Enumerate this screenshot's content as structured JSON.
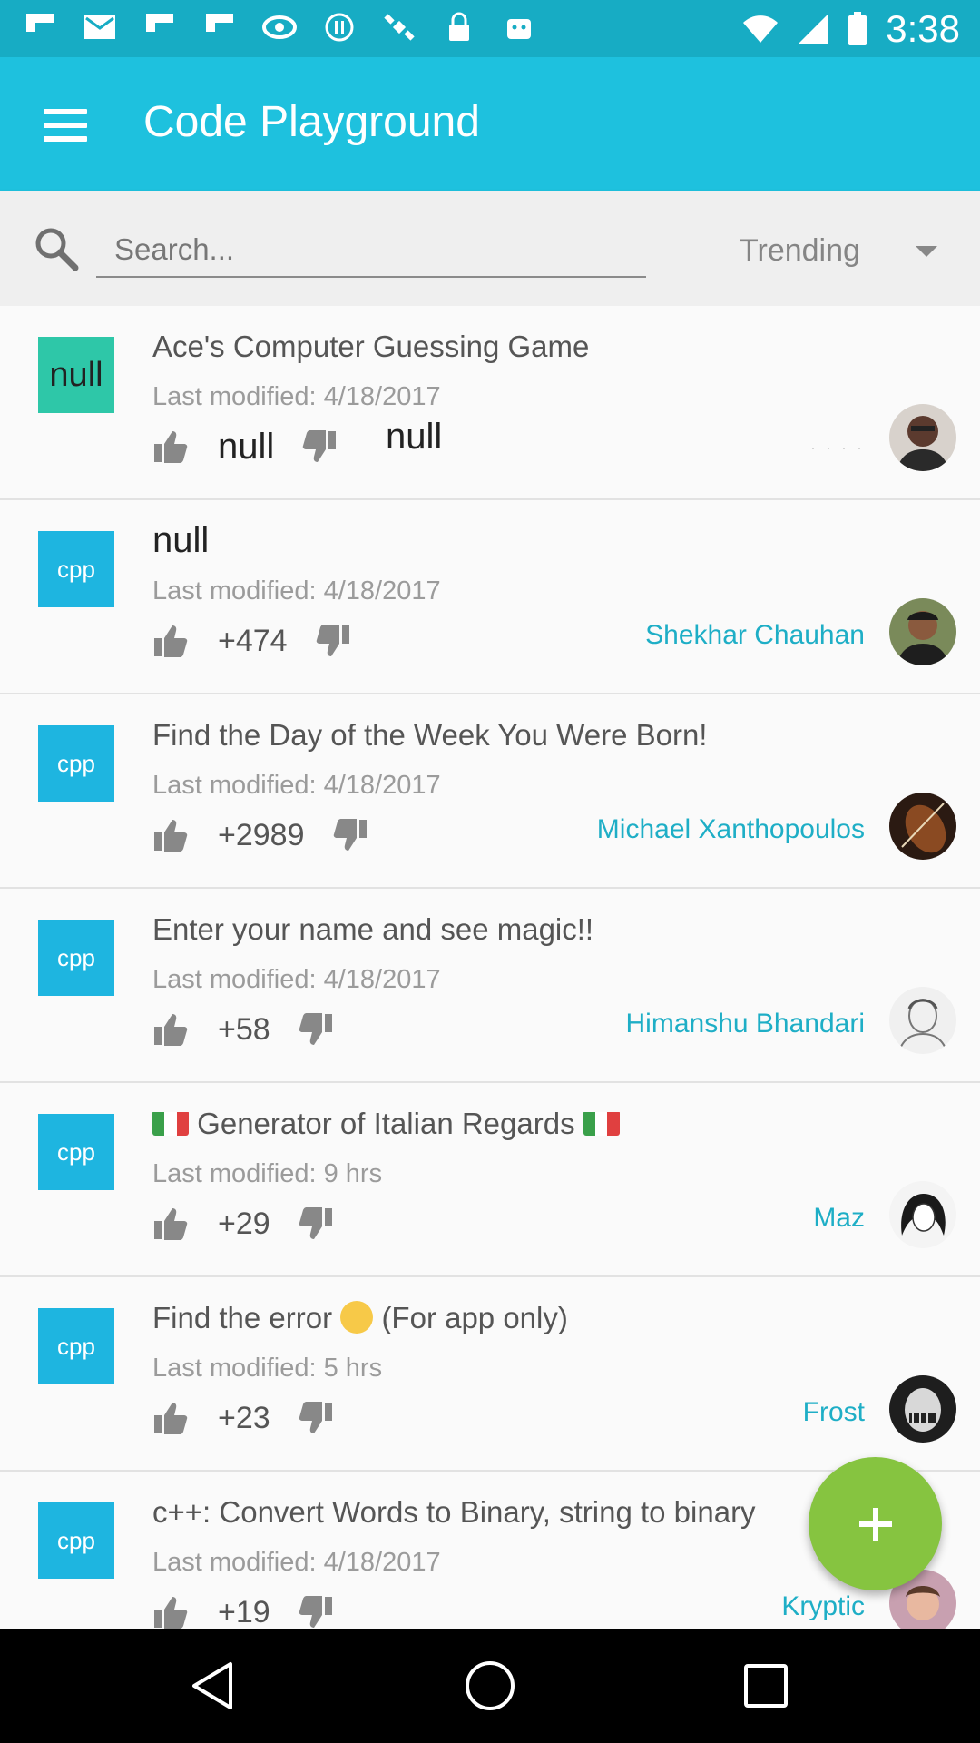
{
  "status_bar": {
    "time": "3:38",
    "icons": [
      "flipboard-icon",
      "mail-icon",
      "flipboard-icon",
      "flipboard-icon",
      "nvidia-icon",
      "pause-icon",
      "satellite-icon",
      "lock-icon",
      "android-icon",
      "wifi-icon",
      "signal-icon",
      "battery-icon"
    ]
  },
  "app_bar": {
    "title": "Code Playground"
  },
  "search": {
    "placeholder": "Search...",
    "sort_value": "Trending"
  },
  "items": [
    {
      "lang": "null",
      "title": "Ace's Computer Guessing Game",
      "date": "Last modified: 4/18/2017",
      "votes": "null",
      "extra": "null",
      "author": "",
      "avatar_color": "#5b3a2e"
    },
    {
      "lang": "cpp",
      "title": "null",
      "date": "Last modified: 4/18/2017",
      "votes": "+474",
      "author": "Shekhar Chauhan",
      "avatar_color": "#3a2a22"
    },
    {
      "lang": "cpp",
      "title": "Find the Day of the Week You Were Born!",
      "date": "Last modified: 4/18/2017",
      "votes": "+2989",
      "author": "Michael Xanthopoulos",
      "avatar_color": "#6b3a22"
    },
    {
      "lang": "cpp",
      "title": "Enter your name and see magic!!",
      "date": "Last modified: 4/18/2017",
      "votes": "+58",
      "author": "Himanshu Bhandari",
      "avatar_color": "#d8d8d8"
    },
    {
      "lang": "cpp",
      "title": "Generator of Italian Regards",
      "date": "Last modified: 9 hrs",
      "votes": "+29",
      "author": "Maz",
      "avatar_color": "#eeeeee"
    },
    {
      "lang": "cpp",
      "title_before": "Find the error",
      "title_after": "(For app only)",
      "date": "Last modified: 5 hrs",
      "votes": "+23",
      "author": "Frost",
      "avatar_color": "#2e2e2e"
    },
    {
      "lang": "cpp",
      "title": "c++: Convert Words to Binary, string to binary",
      "date": "Last modified: 4/18/2017",
      "votes": "+19",
      "author": "Kryptic",
      "avatar_color": "#b07a8a"
    }
  ],
  "colors": {
    "status_bar": "#17acc4",
    "app_bar": "#1ec1de",
    "badge": "#1eb5e0",
    "badge_null": "#2ec7a8",
    "author": "#1eaec6",
    "fab": "#86c440"
  }
}
